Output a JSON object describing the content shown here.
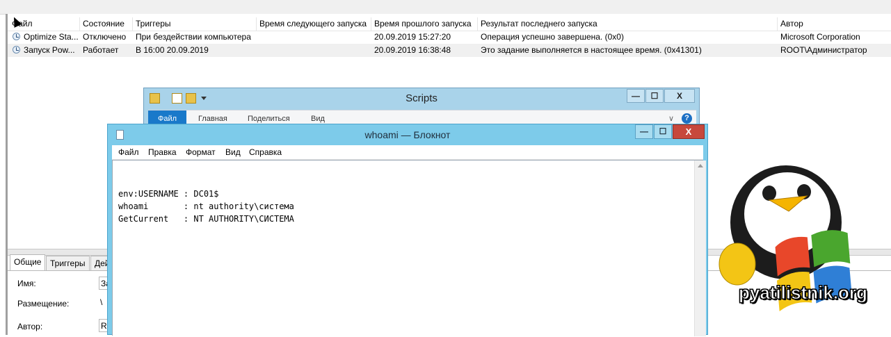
{
  "task_scheduler": {
    "columns": [
      "Файл",
      "Состояние",
      "Триггеры",
      "Время следующего запуска",
      "Время прошлого запуска",
      "Результат последнего запуска",
      "Автор"
    ],
    "rows": [
      {
        "name": "Optimize Sta...",
        "state": "Отключено",
        "triggers": "При бездействии компьютера",
        "next_run": "",
        "last_run": "20.09.2019 15:27:20",
        "result": "Операция успешно завершена. (0x0)",
        "author": "Microsoft Corporation"
      },
      {
        "name": "Запуск Pow...",
        "state": "Работает",
        "triggers": "В 16:00 20.09.2019",
        "next_run": "",
        "last_run": "20.09.2019 16:38:48",
        "result": "Это задание выполняется в настоящее время. (0x41301)",
        "author": "ROOT\\Администратор"
      }
    ],
    "tabs": [
      "Общие",
      "Триггеры",
      "Дей"
    ],
    "props": [
      {
        "label": "Имя:",
        "value": "За"
      },
      {
        "label": "Размещение:",
        "value": "\\"
      },
      {
        "label": "Автор:",
        "value": "R("
      }
    ]
  },
  "explorer": {
    "title": "Scripts",
    "ribbon_tabs": [
      "Файл",
      "Главная",
      "Поделиться",
      "Вид"
    ],
    "minimize": "—",
    "maximize": "☐",
    "close": "X",
    "help": "?",
    "expand": "∨"
  },
  "notepad": {
    "title": "whoami — Блокнот",
    "menu": [
      "Файл",
      "Правка",
      "Формат",
      "Вид",
      "Справка"
    ],
    "lines": [
      "env:USERNAME : DC01$",
      "whoami       : nt authority\\система",
      "GetCurrent   : NT AUTHORITY\\СИСТЕМА"
    ],
    "minimize": "—",
    "maximize": "☐",
    "close": "X"
  },
  "logo": {
    "text": "pyatilistnik.org",
    "colors": {
      "red": "#e8472a",
      "green": "#4aa62e",
      "blue": "#2f7fd6",
      "yellow": "#f3c515",
      "beak": "#f5b400"
    }
  }
}
